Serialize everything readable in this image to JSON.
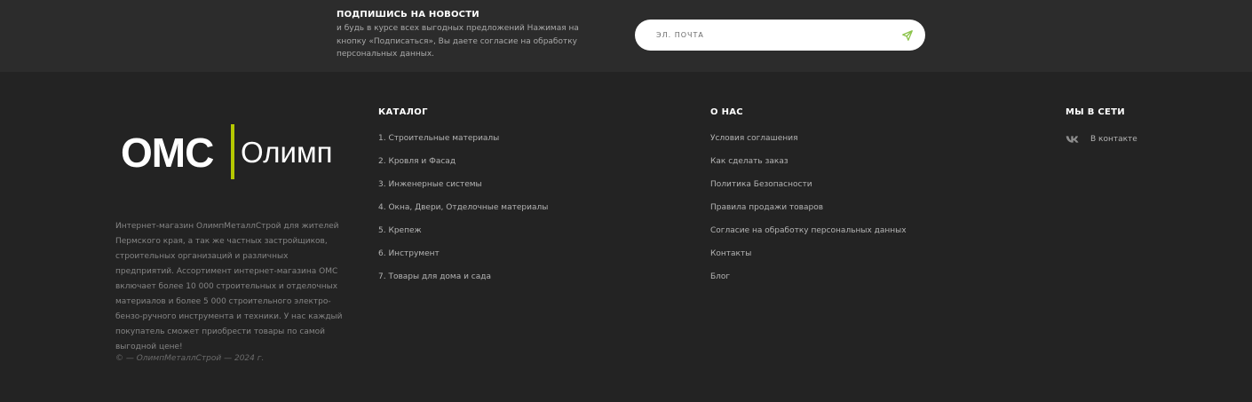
{
  "newsletter": {
    "title": "ПОДПИШИСЬ НА НОВОСТИ",
    "text": "и будь в курсе всех выгодных предложений Нажимая на кнопку «Подписаться», Вы даете согласие на обработку персональных данных.",
    "email_placeholder": "ЭЛ. ПОЧТА",
    "send_icon": "send-arrow-icon",
    "accent_color": "#8bc34a"
  },
  "logo": {
    "oms": "ОМС",
    "olimp": "Олимп",
    "bar_color": "#b5c800"
  },
  "about_text": "Интернет-магазин ОлимпМеталлСтрой для жителей Пермского края, а так же частных застройщиков, строительных организаций и различных предприятий. Ассортимент интернет-магазина ОМС включает более 10 000 строительных и отделочных материалов и более 5 000 строительного электро-бензо-ручного инструмента и техники. У нас каждый покупатель сможет приобрести товары по самой выгодной цене!",
  "copyright": "© — ОлимпМеталлСтрой — 2024 г.",
  "catalog": {
    "title": "КАТАЛОГ",
    "items": [
      "1. Строительные материалы",
      "2. Кровля и Фасад",
      "3. Инженерные системы",
      "4. Окна, Двери, Отделочные материалы",
      "5. Крепеж",
      "6. Инструмент",
      "7. Товары для дома и сада"
    ]
  },
  "about_us": {
    "title": "О НАС",
    "items": [
      "Условия соглашения",
      "Как сделать заказ",
      "Политика Безопасности",
      "Правила продажи товаров",
      "Согласие на обработку персональных данных",
      "Контакты",
      "Блог"
    ]
  },
  "social": {
    "title": "МЫ В СЕТИ",
    "vk_label": "В контакте",
    "vk_icon": "vk-icon"
  }
}
